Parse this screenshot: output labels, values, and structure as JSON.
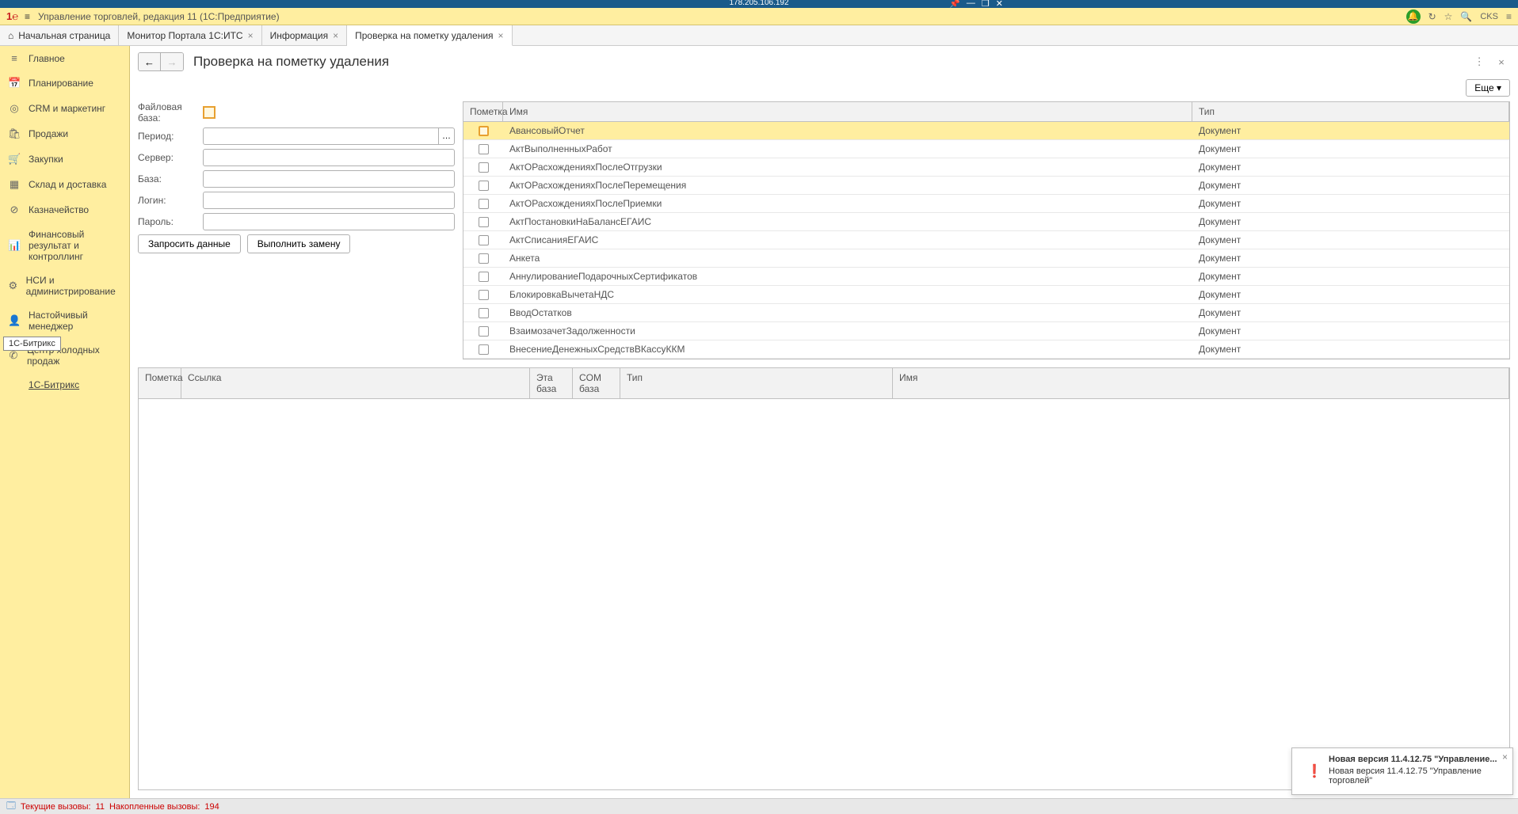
{
  "remote": {
    "ip": "178.205.106.192"
  },
  "window": {
    "title": "Управление торговлей, редакция 11  (1С:Предприятие)",
    "user": "CKS"
  },
  "tabs": [
    {
      "label": "Начальная страница",
      "closable": false,
      "home": true
    },
    {
      "label": "Монитор Портала 1С:ИТС",
      "closable": true
    },
    {
      "label": "Информация",
      "closable": true
    },
    {
      "label": "Проверка на пометку удаления",
      "closable": true,
      "active": true
    }
  ],
  "sidebar": {
    "items": [
      {
        "icon": "≡",
        "label": "Главное"
      },
      {
        "icon": "📅",
        "label": "Планирование"
      },
      {
        "icon": "◎",
        "label": "CRM и маркетинг"
      },
      {
        "icon": "🛍",
        "label": "Продажи"
      },
      {
        "icon": "🛒",
        "label": "Закупки"
      },
      {
        "icon": "▦",
        "label": "Склад и доставка"
      },
      {
        "icon": "⊘",
        "label": "Казначейство"
      },
      {
        "icon": "📊",
        "label": "Финансовый результат и контроллинг"
      },
      {
        "icon": "⚙",
        "label": "НСИ и администрирование"
      },
      {
        "icon": "👤",
        "label": "Настойчивый менеджер"
      },
      {
        "icon": "✆",
        "label": "Центр холодных продаж"
      },
      {
        "icon": "",
        "label": "1С-Битрикс",
        "link": true
      }
    ]
  },
  "tooltip": "1С-Битрикс",
  "page": {
    "title": "Проверка на пометку удаления",
    "more_btn": "Еще ▾",
    "fields": {
      "file_db": "Файловая база:",
      "period": "Период:",
      "server": "Сервер:",
      "base": "База:",
      "login": "Логин:",
      "password": "Пароль:"
    },
    "buttons": {
      "request": "Запросить данные",
      "replace": "Выполнить замену"
    }
  },
  "grid": {
    "headers": {
      "mark": "Пометка",
      "name": "Имя",
      "type": "Тип"
    },
    "rows": [
      {
        "name": "АвансовыйОтчет",
        "type": "Документ",
        "selected": true
      },
      {
        "name": "АктВыполненныхРабот",
        "type": "Документ"
      },
      {
        "name": "АктОРасхожденияхПослеОтгрузки",
        "type": "Документ"
      },
      {
        "name": "АктОРасхожденияхПослеПеремещения",
        "type": "Документ"
      },
      {
        "name": "АктОРасхожденияхПослеПриемки",
        "type": "Документ"
      },
      {
        "name": "АктПостановкиНаБалансЕГАИС",
        "type": "Документ"
      },
      {
        "name": "АктСписанияЕГАИС",
        "type": "Документ"
      },
      {
        "name": "Анкета",
        "type": "Документ"
      },
      {
        "name": "АннулированиеПодарочныхСертификатов",
        "type": "Документ"
      },
      {
        "name": "БлокировкаВычетаНДС",
        "type": "Документ"
      },
      {
        "name": "ВводОстатков",
        "type": "Документ"
      },
      {
        "name": "ВзаимозачетЗадолженности",
        "type": "Документ"
      },
      {
        "name": "ВнесениеДенежныхСредствВКассуККМ",
        "type": "Документ"
      }
    ]
  },
  "bottom_grid": {
    "headers": {
      "mark": "Пометка",
      "ref": "Ссылка",
      "this_base": "Эта база",
      "com_base": "COM база",
      "type": "Тип",
      "name": "Имя"
    }
  },
  "status": {
    "current_calls_label": "Текущие вызовы:",
    "current_calls": "11",
    "accum_calls_label": "Накопленные вызовы:",
    "accum_calls": "194"
  },
  "notification": {
    "line1": "Новая версия 11.4.12.75 \"Управление...",
    "line2": "Новая версия 11.4.12.75 \"Управление торговлей\""
  }
}
